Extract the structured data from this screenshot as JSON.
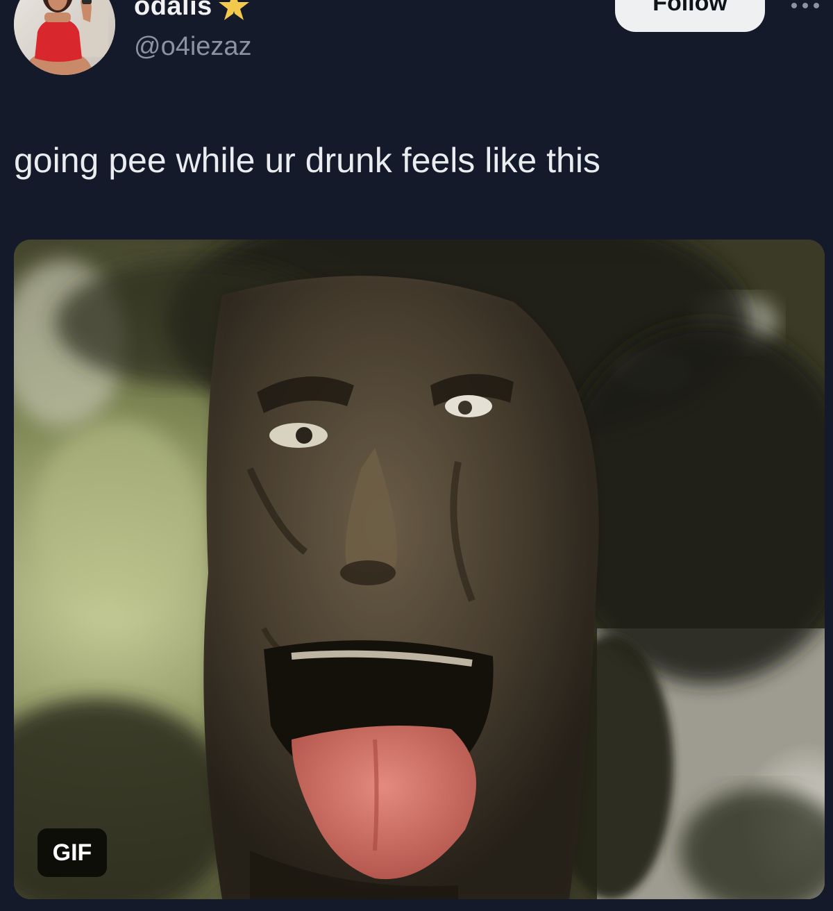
{
  "user": {
    "display_name": "odalis",
    "handle": "@o4iezaz",
    "badge_icon": "star-badge-icon",
    "avatar_icon": "profile-avatar"
  },
  "actions": {
    "follow_label": "Follow",
    "more_icon": "ellipsis-icon"
  },
  "tweet": {
    "text": "going pee while ur drunk feels like this"
  },
  "media": {
    "badge_label": "GIF",
    "image_icon": "talking-tree-face-image"
  },
  "colors": {
    "background": "#151a2a",
    "follow_button_bg": "#eef0f2",
    "handle_text": "#8a93a2",
    "badge_star": "#f2c94c"
  }
}
